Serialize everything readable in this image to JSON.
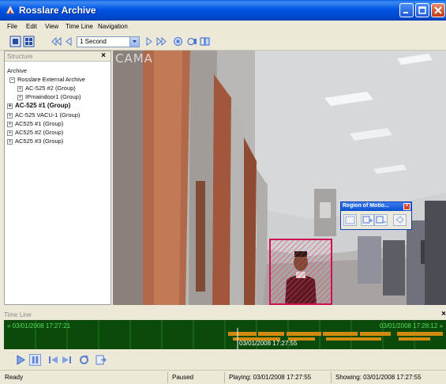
{
  "window": {
    "title": "Rosslare Archive",
    "buttons": [
      "minimize-icon",
      "maximize-icon",
      "close-icon"
    ]
  },
  "menu": [
    "File",
    "Edit",
    "View",
    "Time Line",
    "Navigation"
  ],
  "toolbar": {
    "speed_value": "1 Second",
    "icons": [
      "layout-single-icon",
      "layout-multi-icon",
      "rewind-icon",
      "step-back-icon",
      "play-icon",
      "fast-forward-icon",
      "record-icon",
      "snapshot-icon",
      "export-icon"
    ]
  },
  "structure": {
    "header": "Structure",
    "close": "×",
    "root": "Archive",
    "archive": "Rosslare External Archive",
    "archive_children": [
      "AC-525 #2 (Group)",
      "IPmaindoor1 (Group)"
    ],
    "items": [
      "AC-525 #1 (Group)",
      "AC-525 VACU-1 (Group)",
      "AC525 #1 (Group)",
      "AC525 #2 (Group)",
      "AC525 #3 (Group)"
    ],
    "selected_index": 0
  },
  "video": {
    "camera_label": "CAMA",
    "motion_color": "#d01050"
  },
  "region_dialog": {
    "title": "Region of Motio...",
    "close": "×",
    "icons": [
      "region-select-icon",
      "region-add-icon",
      "region-remove-icon",
      "region-clear-icon"
    ]
  },
  "timeline": {
    "header": "Time Line",
    "close": "×",
    "start": "« 03/01/2008 17:27:21",
    "end": "03/01/2008 17:28:12 »",
    "cursor": "03/01/2008 17:27:55",
    "background_color": "#0b4a0b",
    "activity_color": "#d48a10"
  },
  "transport": {
    "icons": [
      "play-icon",
      "pause-icon",
      "skip-start-icon",
      "skip-end-icon",
      "refresh-icon",
      "export-icon"
    ]
  },
  "status": {
    "ready": "Ready",
    "state": "Paused",
    "playing": "Playing: 03/01/2008 17:27:55",
    "showing": "Showing: 03/01/2008 17:27:55"
  }
}
